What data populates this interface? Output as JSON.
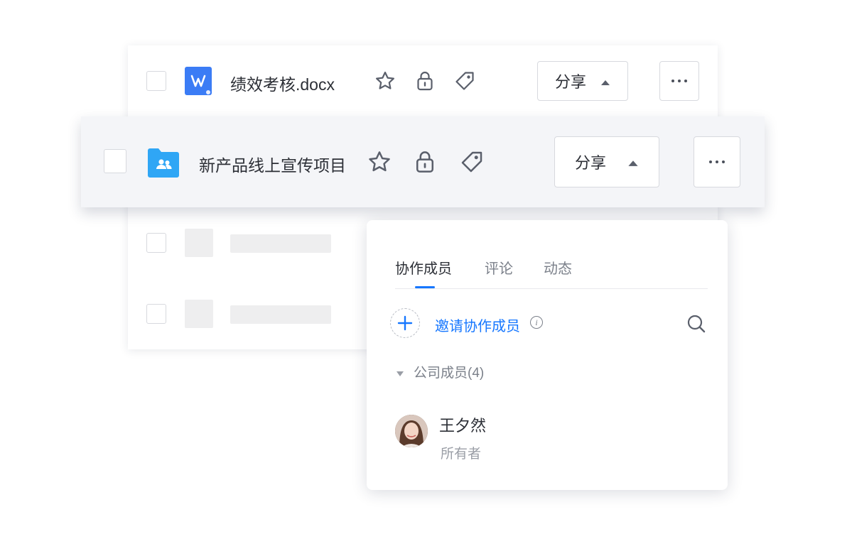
{
  "files": [
    {
      "name": "绩效考核.docx",
      "icon": "word-doc-icon",
      "share_label": "分享",
      "icon_color": "#3b7cf5"
    },
    {
      "name": "新产品线上宣传项目",
      "icon": "shared-folder-icon",
      "share_label": "分享",
      "icon_color": "#2fa6f5"
    }
  ],
  "panel": {
    "tabs": [
      "协作成员",
      "评论",
      "动态"
    ],
    "active_tab": "协作成员",
    "invite_label": "邀请协作成员",
    "info_glyph": "i",
    "group_label": "公司成员(4)",
    "members": [
      {
        "name": "王夕然",
        "role": "所有者"
      }
    ]
  },
  "colors": {
    "accent": "#1677ff",
    "text": "#2c2f36",
    "muted": "#7b808a",
    "border": "#d7d9de",
    "highlight_row": "#f4f5f8"
  }
}
